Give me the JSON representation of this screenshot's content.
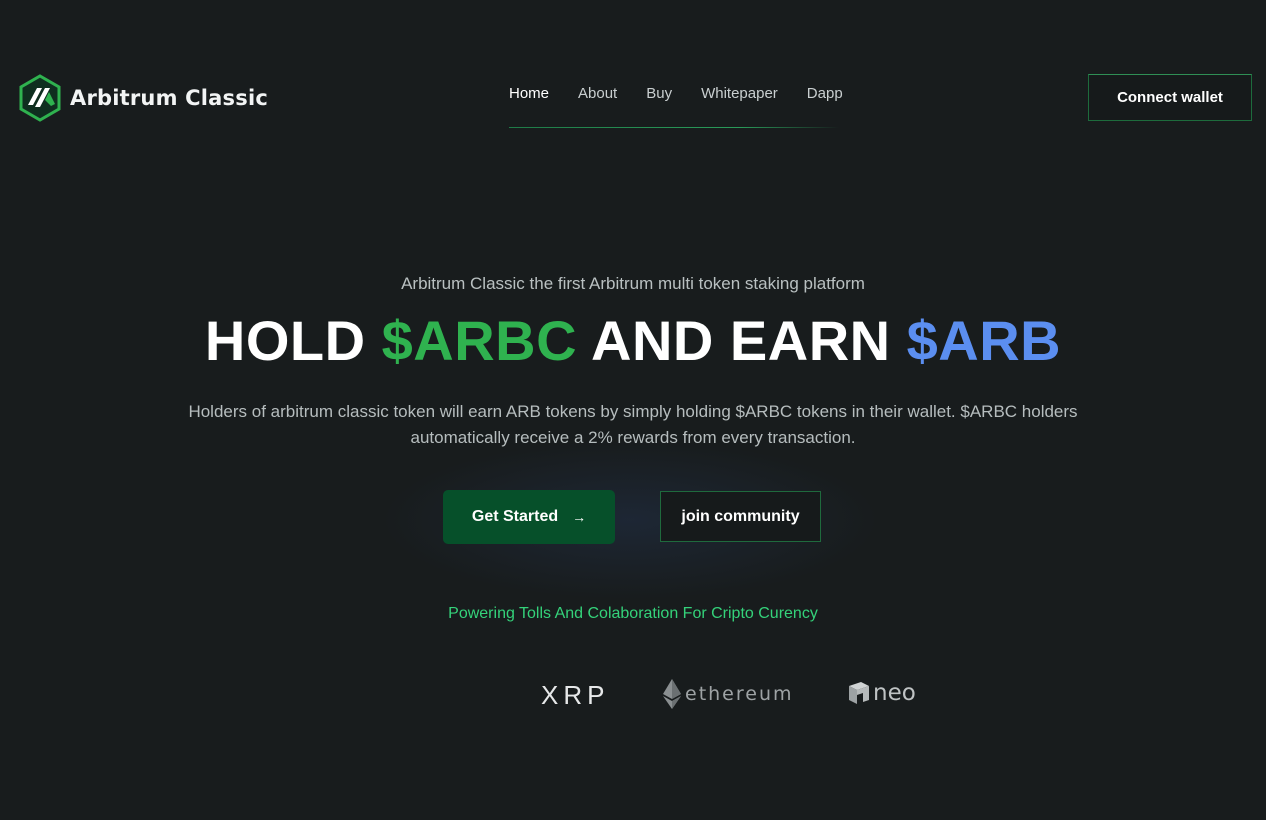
{
  "brand": {
    "name": "Arbitrum Classic",
    "accent_green": "#2fb24f",
    "accent_blue": "#5b8ef0",
    "background": "#181c1d"
  },
  "nav": {
    "items": [
      {
        "label": "Home",
        "active": true
      },
      {
        "label": "About",
        "active": false
      },
      {
        "label": "Buy",
        "active": false
      },
      {
        "label": "Whitepaper",
        "active": false
      },
      {
        "label": "Dapp",
        "active": false
      }
    ]
  },
  "header": {
    "connect_label": "Connect wallet"
  },
  "hero": {
    "tagline": "Arbitrum Classic the first Arbitrum multi token staking platform",
    "headline": {
      "part1": "HOLD ",
      "part2": "$ARBC",
      "part3": " AND EARN ",
      "part4": "$ARB"
    },
    "description": "Holders of arbitrum classic token will earn ARB tokens by simply holding $ARBC tokens in their wallet. $ARBC holders automatically receive a 2% rewards from every transaction.",
    "primary_button": "Get Started",
    "primary_button_icon": "arrow-right-icon",
    "secondary_button": "join community"
  },
  "partners": {
    "caption": "Powering Tolls And Colaboration For Cripto Curency",
    "logos": [
      {
        "name": "XRP",
        "icon": "xrp-logo"
      },
      {
        "name": "ethereum",
        "icon": "ethereum-logo"
      },
      {
        "name": "neo",
        "icon": "neo-logo"
      }
    ]
  }
}
